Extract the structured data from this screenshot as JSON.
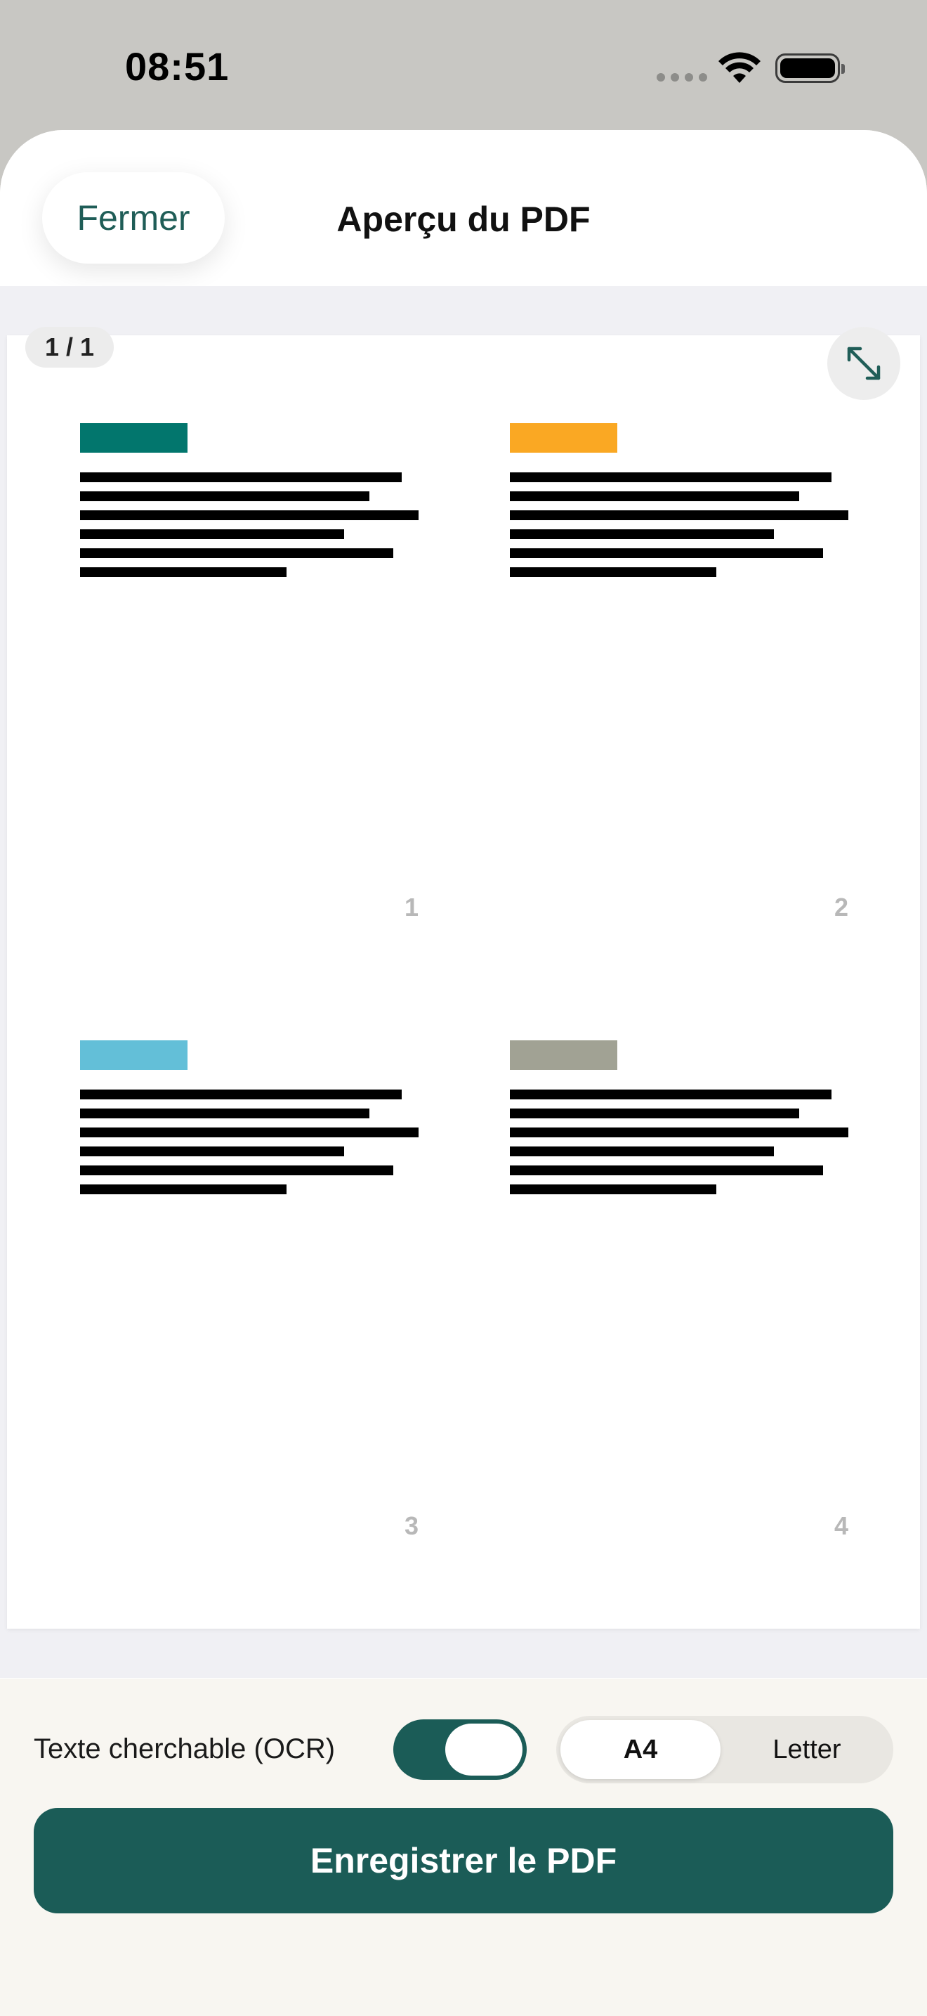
{
  "status_bar": {
    "time": "08:51"
  },
  "nav": {
    "close_label": "Fermer",
    "title": "Aperçu du PDF"
  },
  "preview": {
    "page_counter": "1 / 1",
    "pages": [
      {
        "number": "1",
        "color": "#02766d"
      },
      {
        "number": "2",
        "color": "#faa823"
      },
      {
        "number": "3",
        "color": "#63bfd8"
      },
      {
        "number": "4",
        "color": "#a1a294"
      }
    ]
  },
  "options": {
    "ocr_label": "Texte cherchable (OCR)",
    "ocr_enabled": true,
    "paper_sizes": [
      "A4",
      "Letter"
    ],
    "selected_paper_size": "A4"
  },
  "save_label": "Enregistrer le PDF",
  "colors": {
    "accent": "#1b5c57",
    "background": "#f0f0f4"
  }
}
